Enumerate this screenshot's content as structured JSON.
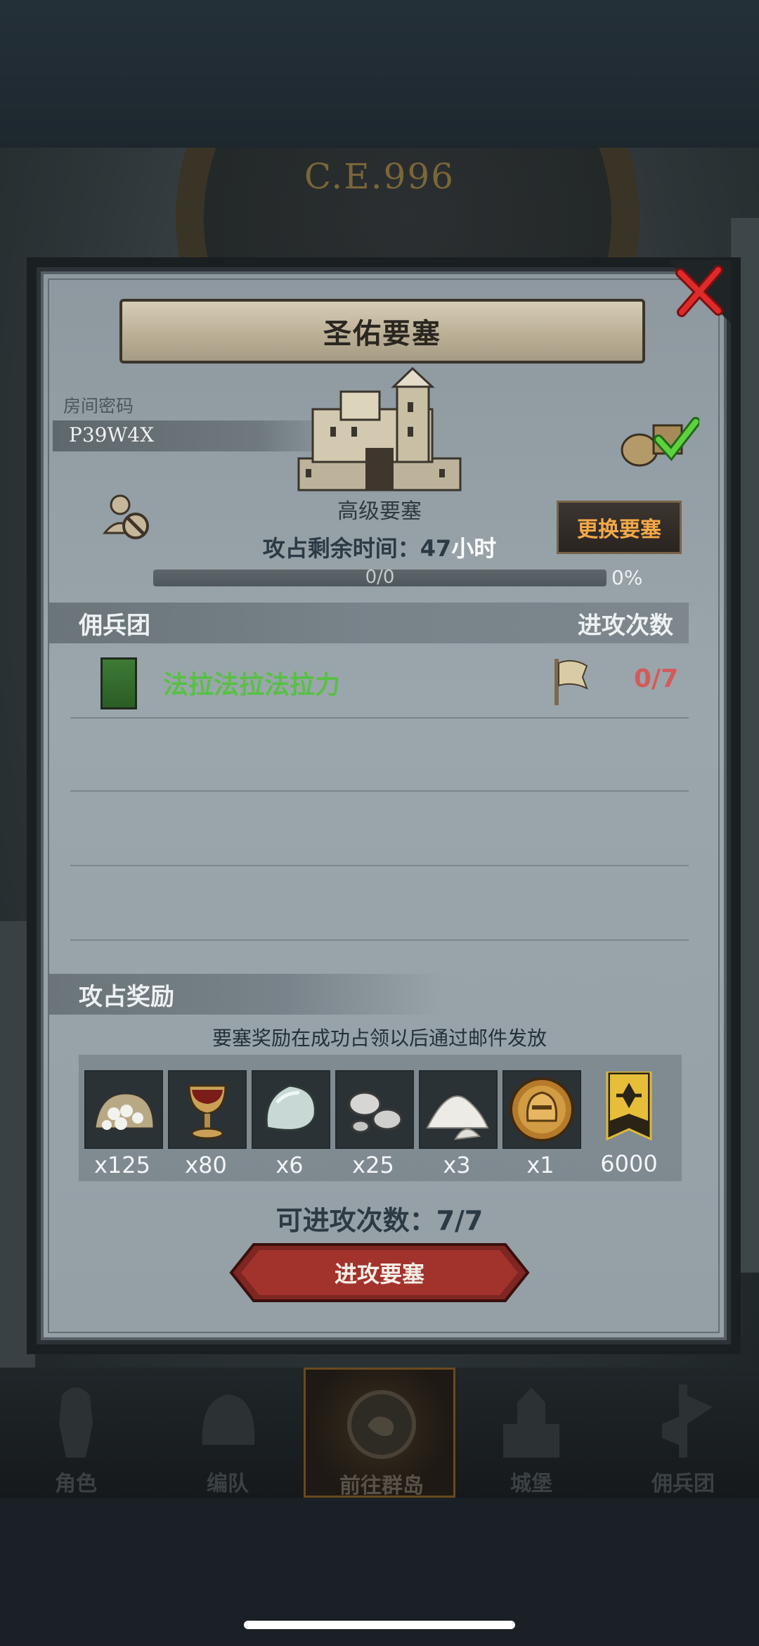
{
  "background": {
    "year": "C.E.996"
  },
  "modal": {
    "title": "圣佑要塞",
    "room_label": "房间密码",
    "room_code": "P39W4X",
    "fortress_name": "高级要塞",
    "change_button": "更换要塞",
    "timer_prefix": "攻占剩余时间：47",
    "timer_suffix": "小时",
    "progress_text": "0/0",
    "progress_percent": "0%",
    "progress_value": 0,
    "mercenary_header": "佣兵团",
    "attack_header": "进攻次数",
    "guilds": [
      {
        "name": "法拉法拉法拉力",
        "attacks": "0/7"
      }
    ],
    "reward_header": "攻占奖励",
    "reward_note": "要塞奖励在成功占领以后通过邮件发放",
    "rewards": [
      {
        "icon": "silver-ore-sack-icon",
        "qty": "x125"
      },
      {
        "icon": "goblet-icon",
        "qty": "x80"
      },
      {
        "icon": "moonstone-icon",
        "qty": "x6"
      },
      {
        "icon": "silver-nuggets-icon",
        "qty": "x25"
      },
      {
        "icon": "salt-pile-icon",
        "qty": "x3"
      },
      {
        "icon": "golden-helmet-medal-icon",
        "qty": "x1"
      }
    ],
    "honor_qty": "6000",
    "remaining_attacks": "可进攻次数：7/7",
    "attack_button": "进攻要塞"
  },
  "nav": [
    {
      "label": "角色",
      "icon": "knight-icon"
    },
    {
      "label": "编队",
      "icon": "helmet-icon"
    },
    {
      "label": "前往群岛",
      "icon": "compass-map-icon"
    },
    {
      "label": "城堡",
      "icon": "castle-icon"
    },
    {
      "label": "佣兵团",
      "icon": "banner-icon"
    }
  ],
  "colors": {
    "guild_name": "#58c045",
    "attack_count": "#d55a5a",
    "change_button_text": "#f3a848"
  }
}
